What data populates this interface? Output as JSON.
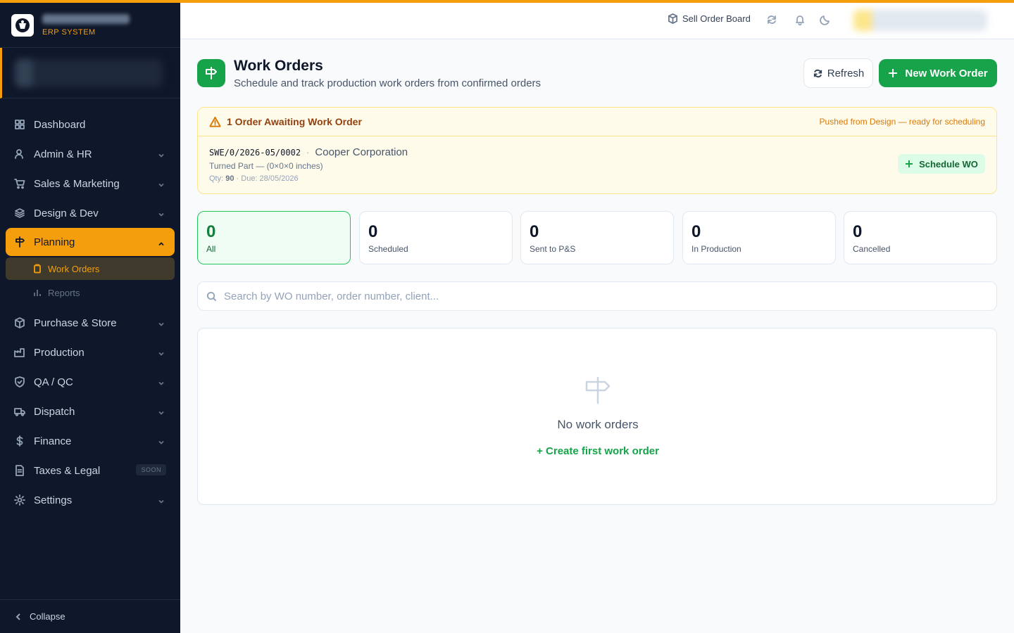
{
  "brand": {
    "subtitle": "ERP SYSTEM"
  },
  "header": {
    "sell_order_board": "Sell Order Board",
    "icons": [
      "refresh-icon",
      "bell-icon",
      "moon-icon"
    ]
  },
  "sidebar": {
    "items": [
      {
        "label": "Dashboard",
        "icon": "grid-icon"
      },
      {
        "label": "Admin & HR",
        "icon": "user-icon"
      },
      {
        "label": "Sales & Marketing",
        "icon": "cart-icon"
      },
      {
        "label": "Design & Dev",
        "icon": "layers-icon"
      },
      {
        "label": "Planning",
        "icon": "signpost-icon"
      },
      {
        "label": "Purchase & Store",
        "icon": "package-icon"
      },
      {
        "label": "Production",
        "icon": "factory-icon"
      },
      {
        "label": "QA / QC",
        "icon": "shield-icon"
      },
      {
        "label": "Dispatch",
        "icon": "truck-icon"
      },
      {
        "label": "Finance",
        "icon": "dollar-icon"
      },
      {
        "label": "Taxes & Legal",
        "icon": "document-icon",
        "badge": "SOON"
      },
      {
        "label": "Settings",
        "icon": "gear-icon"
      }
    ],
    "planning_sub": [
      {
        "label": "Work Orders",
        "icon": "clipboard-icon"
      },
      {
        "label": "Reports",
        "icon": "bar-chart-icon"
      }
    ],
    "collapse": "Collapse"
  },
  "page": {
    "title": "Work Orders",
    "subtitle": "Schedule and track production work orders from confirmed orders",
    "refresh_label": "Refresh",
    "new_label": "New Work Order"
  },
  "alert": {
    "title": "1 Order Awaiting Work Order",
    "note": "Pushed from Design — ready for scheduling",
    "order_no": "SWE/0/2026-05/0002",
    "client": "Cooper Corporation",
    "part": "Turned Part — (0×0×0 inches)",
    "qty_label": "Qty:",
    "qty": "90",
    "due": "· Due: 28/05/2026",
    "schedule_label": "Schedule WO"
  },
  "stats": [
    {
      "value": "0",
      "label": "All"
    },
    {
      "value": "0",
      "label": "Scheduled"
    },
    {
      "value": "0",
      "label": "Sent to P&S"
    },
    {
      "value": "0",
      "label": "In Production"
    },
    {
      "value": "0",
      "label": "Cancelled"
    }
  ],
  "search": {
    "placeholder": "Search by WO number, order number, client..."
  },
  "empty": {
    "title": "No work orders",
    "link": "+ Create first work order"
  },
  "colors": {
    "accent": "#f59e0b",
    "primary": "#16a34a",
    "sidebar_bg": "#0f172a"
  }
}
